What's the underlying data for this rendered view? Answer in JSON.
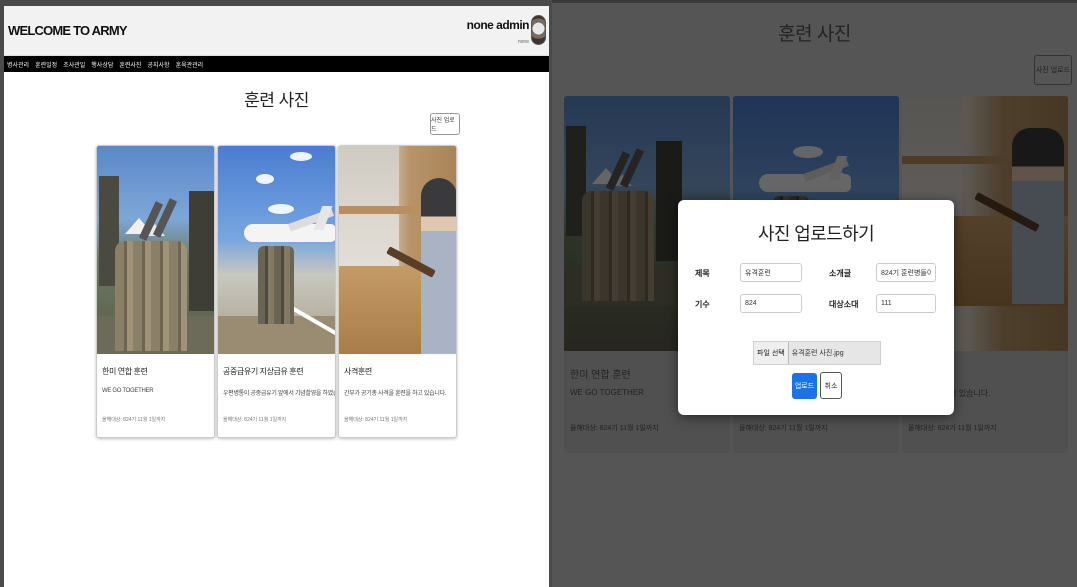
{
  "left": {
    "brand": "WELCOME TO ARMY",
    "user": {
      "name": "none admin",
      "sub": "none"
    },
    "nav": [
      "병사관리",
      "훈련일정",
      "조사관일",
      "행사상담",
      "훈련사진",
      "공지사항",
      "훈육관관리"
    ],
    "page_title": "훈련 사진",
    "upload_button": "사진 업로드",
    "cards": [
      {
        "title": "한미 연합 훈련",
        "desc": "WE GO TOGETHER",
        "meta": "올해대상: 824기 11월 1일까지"
      },
      {
        "title": "공중급유기 지상급유 훈련",
        "desc": "우편병통이 공중급유기 앞에서 기념촬영을 하였습니다.",
        "meta": "올해대상: 824기 11월 1일까지"
      },
      {
        "title": "사격훈련",
        "desc": "간부가 공기총 사격을 훈련을 하고 있습니다.",
        "meta": "올해대상: 824기 11월 1일까지"
      }
    ]
  },
  "right": {
    "page_title": "훈련 사진",
    "upload_button": "사진 업로드",
    "cards": [
      {
        "title": "한미 연합 훈련",
        "desc": "WE GO TOGETHER",
        "meta": "올해대상: 824기 11월 1일까지"
      },
      {
        "title": "",
        "desc": "",
        "meta": "올해대상: 824기 11월 1일까지"
      },
      {
        "title": "",
        "desc": "을 훈련을 하고 있습니다.",
        "meta": "올해대상: 824기 11월 1일까지"
      }
    ],
    "modal": {
      "title": "사진 업로드하기",
      "fields": {
        "title_label": "제목",
        "title_value": "유격훈련",
        "intro_label": "소개글",
        "intro_value": "824기 훈련병들이 유격",
        "class_label": "기수",
        "class_value": "824",
        "target_label": "대상소대",
        "target_value": "111"
      },
      "file_button": "파일 선택",
      "file_name": "유격훈련 사진.jpg",
      "submit": "업로드",
      "cancel": "취소"
    }
  },
  "colors": {
    "primary": "#1a73e8",
    "navbar": "#000000",
    "overlay": "#555555"
  }
}
